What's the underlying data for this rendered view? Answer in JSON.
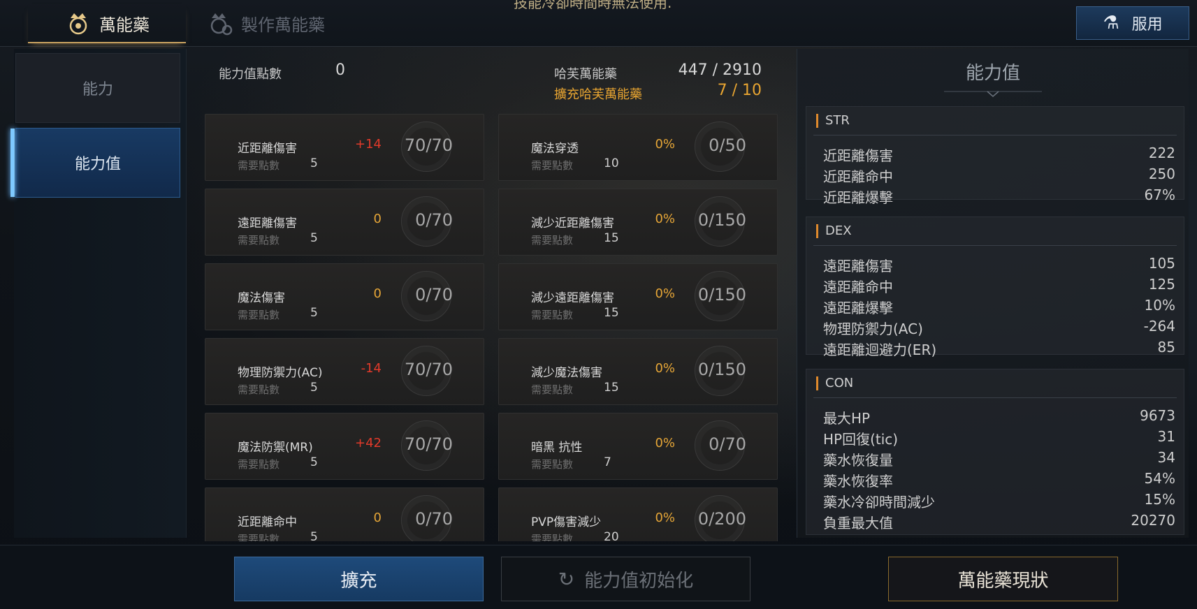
{
  "notice": "技能冷卻時間時無法使用.",
  "tabs": [
    {
      "label": "萬能藥",
      "icon": "crown-potion-icon",
      "active": true
    },
    {
      "label": "製作萬能藥",
      "icon": "crafting-gear-icon",
      "active": false
    }
  ],
  "use_button": {
    "label": "服用",
    "icon": "potion-hand-icon"
  },
  "sidebar": [
    {
      "label": "能力",
      "active": false
    },
    {
      "label": "能力值",
      "active": true
    }
  ],
  "header": {
    "points_label": "能力值點數",
    "points_value": "0",
    "elixir_label": "哈芙萬能藥",
    "elixir_value": "447 / 2910",
    "expand_label": "擴充哈芙萬能藥",
    "expand_value": "7 / 10"
  },
  "required_label": "需要點數",
  "stats_left": [
    {
      "name": "近距離傷害",
      "bonus": "+14",
      "bonus_color": "red",
      "level": "70/70",
      "required": "5"
    },
    {
      "name": "遠距離傷害",
      "bonus": "0",
      "bonus_color": "orange",
      "level": "0/70",
      "required": "5"
    },
    {
      "name": "魔法傷害",
      "bonus": "0",
      "bonus_color": "orange",
      "level": "0/70",
      "required": "5"
    },
    {
      "name": "物理防禦力(AC)",
      "bonus": "-14",
      "bonus_color": "red",
      "level": "70/70",
      "required": "5"
    },
    {
      "name": "魔法防禦(MR)",
      "bonus": "+42",
      "bonus_color": "red",
      "level": "70/70",
      "required": "5"
    },
    {
      "name": "近距離命中",
      "bonus": "0",
      "bonus_color": "orange",
      "level": "0/70",
      "required": "5"
    }
  ],
  "stats_right": [
    {
      "name": "魔法穿透",
      "bonus": "0%",
      "bonus_color": "orange",
      "level": "0/50",
      "required": "10"
    },
    {
      "name": "減少近距離傷害",
      "bonus": "0%",
      "bonus_color": "orange",
      "level": "0/150",
      "required": "15"
    },
    {
      "name": "減少遠距離傷害",
      "bonus": "0%",
      "bonus_color": "orange",
      "level": "0/150",
      "required": "15"
    },
    {
      "name": "減少魔法傷害",
      "bonus": "0%",
      "bonus_color": "orange",
      "level": "0/150",
      "required": "15"
    },
    {
      "name": "暗黑 抗性",
      "bonus": "0%",
      "bonus_color": "orange",
      "level": "0/70",
      "required": "7"
    },
    {
      "name": "PVP傷害減少",
      "bonus": "0%",
      "bonus_color": "orange",
      "level": "0/200",
      "required": "20"
    }
  ],
  "panel": {
    "title": "能力值",
    "groups": [
      {
        "title": "STR",
        "rows": [
          {
            "label": "近距離傷害",
            "value": "222"
          },
          {
            "label": "近距離命中",
            "value": "250"
          },
          {
            "label": "近距離爆擊",
            "value": "67%"
          }
        ]
      },
      {
        "title": "DEX",
        "rows": [
          {
            "label": "遠距離傷害",
            "value": "105"
          },
          {
            "label": "遠距離命中",
            "value": "125"
          },
          {
            "label": "遠距離爆擊",
            "value": "10%"
          },
          {
            "label": "物理防禦力(AC)",
            "value": "-264"
          },
          {
            "label": "遠距離迴避力(ER)",
            "value": "85"
          }
        ]
      },
      {
        "title": "CON",
        "rows": [
          {
            "label": "最大HP",
            "value": "9673"
          },
          {
            "label": "HP回復(tic)",
            "value": "31"
          },
          {
            "label": "藥水恢復量",
            "value": "34"
          },
          {
            "label": "藥水恢復率",
            "value": "54%"
          },
          {
            "label": "藥水冷卻時間減少",
            "value": "15%"
          },
          {
            "label": "負重最大值",
            "value": "20270"
          }
        ]
      }
    ]
  },
  "bottom": {
    "expand": "擴充",
    "reset": "能力值初始化",
    "reset_icon": "refresh-icon",
    "status": "萬能藥現狀"
  },
  "colors": {
    "accent_blue": "#1e4a7a",
    "bonus_orange": "#e6a637",
    "bonus_red": "#e23a2a",
    "gold": "#c8a260"
  }
}
